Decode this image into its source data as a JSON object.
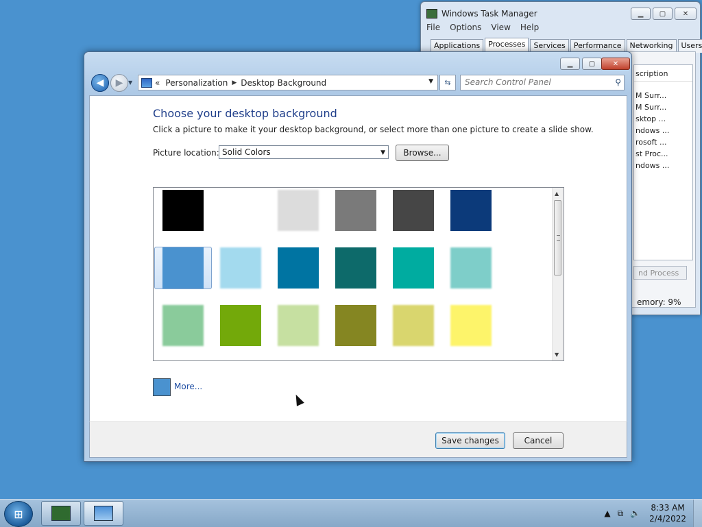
{
  "taskmgr": {
    "title": "Windows Task Manager",
    "menu": [
      "File",
      "Options",
      "View",
      "Help"
    ],
    "tabs": [
      "Applications",
      "Processes",
      "Services",
      "Performance",
      "Networking",
      "Users"
    ],
    "active_tab": "Processes",
    "column_header": "scription",
    "rows": [
      "M Surr...",
      "M Surr...",
      "sktop ...",
      "ndows ...",
      "rosoft ...",
      "st Proc...",
      "ndows ..."
    ],
    "end_process": "nd Process",
    "memory": "emory: 9%"
  },
  "window": {
    "address": {
      "chevron": "«",
      "crumbs": [
        "Personalization",
        "Desktop Background"
      ]
    },
    "search_placeholder": "Search Control Panel",
    "title": "Choose your desktop background",
    "subtitle": "Click a picture to make it your desktop background, or select more than one picture to create a slide show.",
    "picture_location_label": "Picture location:",
    "picture_location_value": "Solid Colors",
    "browse_label": "Browse...",
    "more_label": "More...",
    "save_label": "Save changes",
    "cancel_label": "Cancel"
  },
  "swatches": [
    [
      "#000000",
      "#ffffff",
      "#dcdcdc",
      "#7a7a7a",
      "#464646",
      "#0c3a7a"
    ],
    [
      "#4a92cf",
      "#a3daee",
      "#0074a2",
      "#0d6a6a",
      "#00aca0",
      "#7ecec9"
    ],
    [
      "#8acb9b",
      "#73a90a",
      "#c6e0a1",
      "#858622",
      "#d9d66e",
      "#fdf46a"
    ]
  ],
  "selected_swatch": "#4a92cf",
  "taskbar": {
    "clock_time": "8:33 AM",
    "clock_date": "2/4/2022"
  }
}
